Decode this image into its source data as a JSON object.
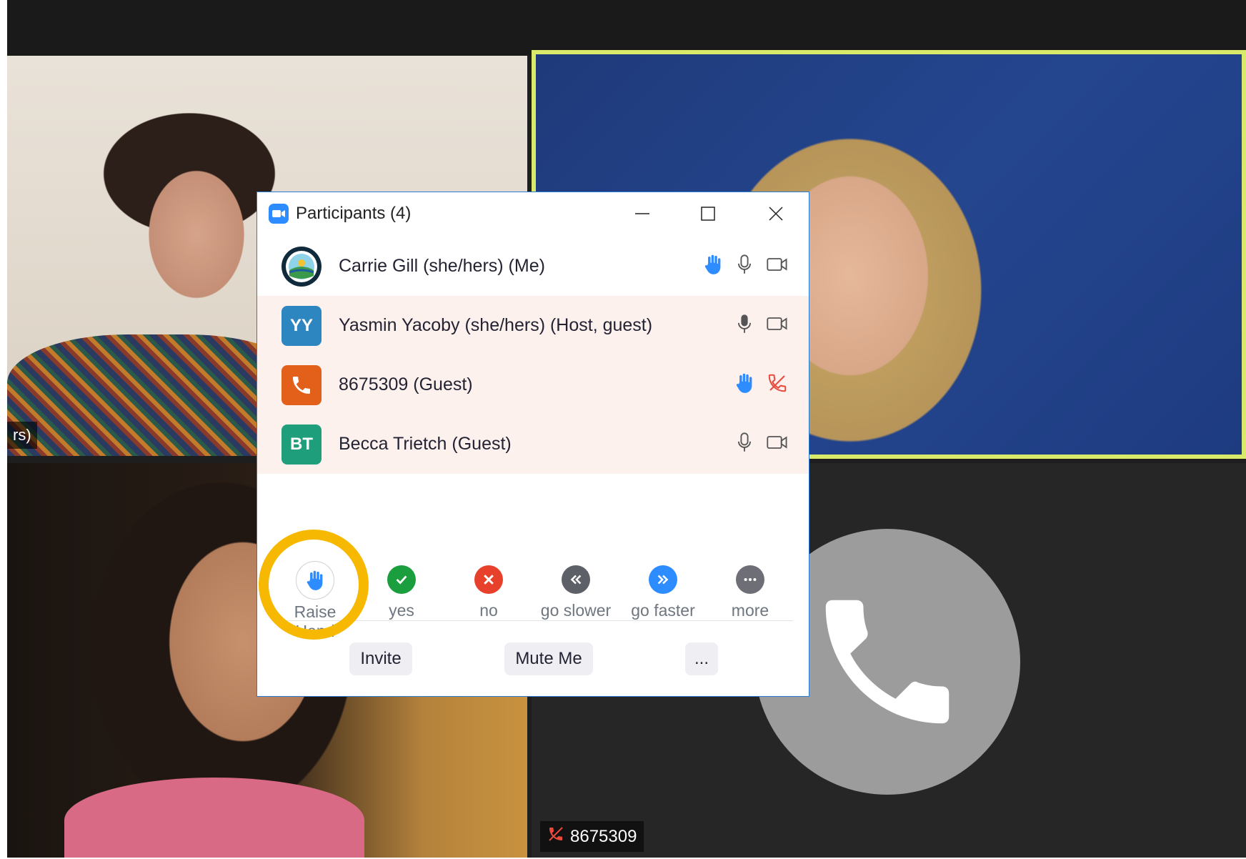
{
  "window": {
    "title": "Participants (4)"
  },
  "participants": [
    {
      "name": "Carrie Gill (she/hers) (Me)",
      "initials": "",
      "avatar_type": "logo",
      "hand_raised": true,
      "audio": "mic",
      "video": "camera"
    },
    {
      "name": "Yasmin Yacoby (she/hers) (Host, guest)",
      "initials": "YY",
      "avatar_color": "#2e86c1",
      "hand_raised": false,
      "audio": "mic",
      "video": "camera"
    },
    {
      "name": "8675309 (Guest)",
      "initials": "",
      "avatar_type": "phone",
      "avatar_color": "#e2601a",
      "hand_raised": true,
      "audio": "phone-muted",
      "video": "none"
    },
    {
      "name": "Becca Trietch (Guest)",
      "initials": "BT",
      "avatar_color": "#1f9e7c",
      "hand_raised": false,
      "audio": "mic",
      "video": "camera"
    }
  ],
  "reactions": [
    {
      "label": "Raise Hand",
      "icon": "raise-hand-icon"
    },
    {
      "label": "yes",
      "icon": "check-icon",
      "color": "#1b9f3e"
    },
    {
      "label": "no",
      "icon": "x-icon",
      "color": "#e8412b"
    },
    {
      "label": "go slower",
      "icon": "rewind-icon",
      "color": "#5e6068"
    },
    {
      "label": "go faster",
      "icon": "fast-forward-icon",
      "color": "#2d8cff"
    },
    {
      "label": "more",
      "icon": "ellipsis-icon",
      "color": "#6e6e76"
    }
  ],
  "footer": {
    "invite_label": "Invite",
    "mute_label": "Mute Me",
    "more_label": "..."
  },
  "video_tiles": {
    "top_left_name_fragment": "rs)",
    "bottom_right_name": "8675309"
  },
  "colors": {
    "active_speaker_border": "#d9e96a",
    "highlight_ring": "#f6b800",
    "hand_icon": "#2d8cff"
  }
}
